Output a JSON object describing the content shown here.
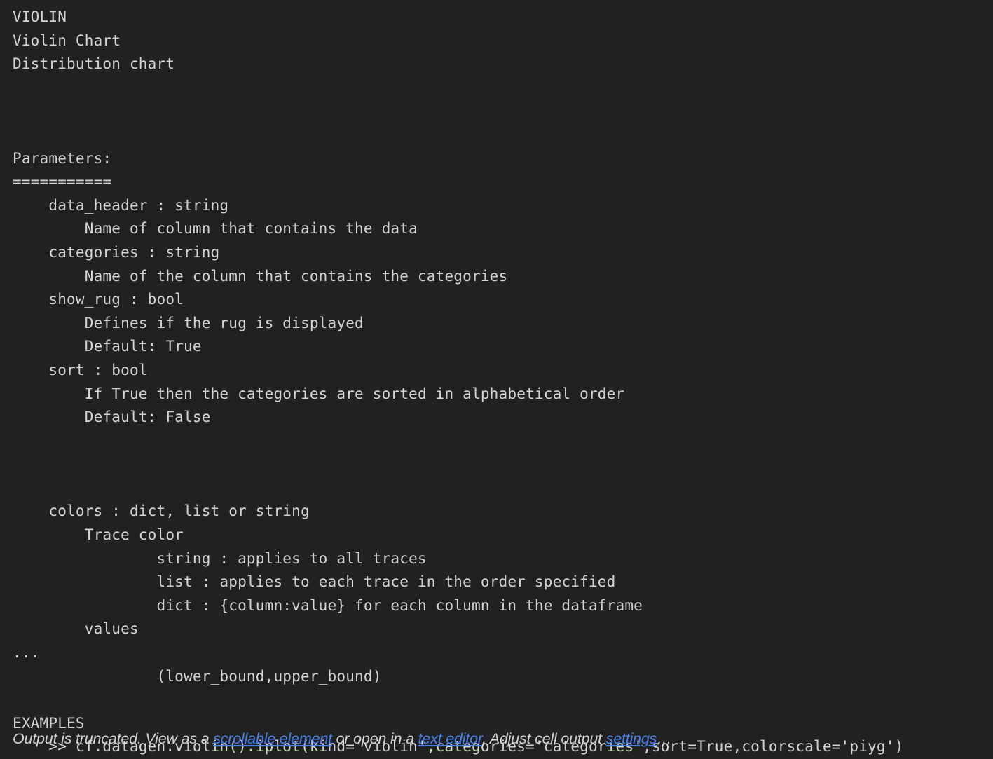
{
  "output": {
    "kind": "jupyter-cell-output",
    "background_color": "#212121",
    "text_color": "#d4d4d4",
    "link_color": "#4a81e8",
    "docstring_lines": [
      "VIOLIN",
      "Violin Chart",
      "Distribution chart",
      "",
      "",
      "",
      "Parameters:",
      "===========",
      "    data_header : string",
      "        Name of column that contains the data",
      "    categories : string",
      "        Name of the column that contains the categories",
      "    show_rug : bool",
      "        Defines if the rug is displayed",
      "        Default: True",
      "    sort : bool",
      "        If True then the categories are sorted in alphabetical order",
      "        Default: False",
      "",
      "",
      "",
      "    colors : dict, list or string",
      "        Trace color",
      "                string : applies to all traces",
      "                list : applies to each trace in the order specified",
      "                dict : {column:value} for each column in the dataframe",
      "        values",
      "...",
      "                (lower_bound,upper_bound)",
      "",
      "EXAMPLES",
      "    >> cf.datagen.violin().iplot(kind='violin',categories='categories',sort=True,colorscale='piyg')"
    ]
  },
  "truncation_notice": {
    "segment_1": "Output is truncated. View as a ",
    "link_scrollable": "scrollable element",
    "segment_2": " or open in a ",
    "link_text_editor": "text editor",
    "segment_3": ". Adjust cell output ",
    "link_settings": "settings",
    "segment_4": "…"
  }
}
